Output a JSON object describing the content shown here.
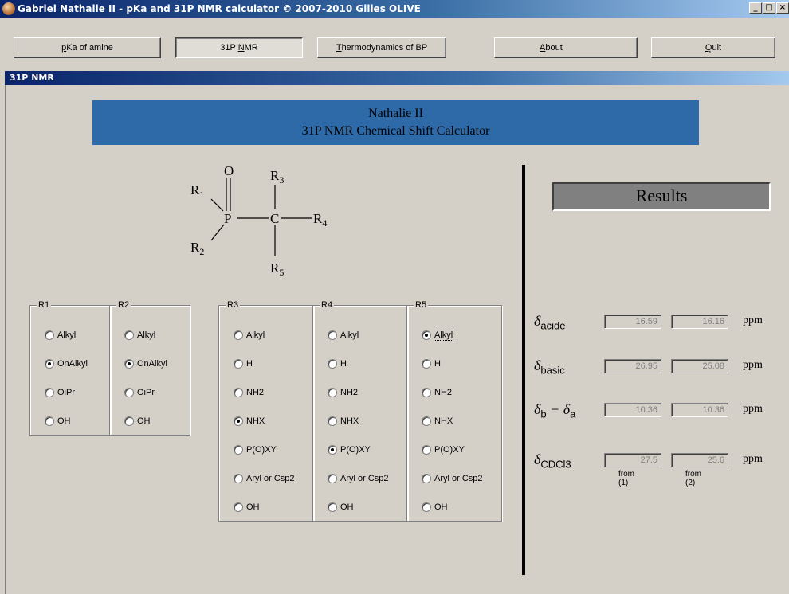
{
  "window": {
    "title": "Gabriel Nathalie II - pKa and 31P NMR calculator © 2007-2010 Gilles OLIVE",
    "min": "_",
    "max": "□",
    "close": "×"
  },
  "toolbar": {
    "pka": [
      "",
      "p",
      "Ka of amine"
    ],
    "nmr": [
      "31P ",
      "N",
      "MR"
    ],
    "thermo": [
      "",
      "T",
      "hermodynamics of BP"
    ],
    "about": [
      "",
      "A",
      "bout"
    ],
    "quit": [
      "",
      "Q",
      "uit"
    ]
  },
  "child": {
    "title": "31P NMR"
  },
  "banner": {
    "line1": "Nathalie II",
    "line2": "31P NMR Chemical Shift Calculator"
  },
  "molecule": {
    "O": "O",
    "P": "P",
    "C": "C",
    "R1": [
      "R",
      "1"
    ],
    "R2": [
      "R",
      "2"
    ],
    "R3": [
      "R",
      "3"
    ],
    "R4": [
      "R",
      "4"
    ],
    "R5": [
      "R",
      "5"
    ]
  },
  "groups": {
    "R1": {
      "label": "R1",
      "options": [
        "Alkyl",
        "OnAlkyl",
        "OiPr",
        "OH"
      ],
      "selected": 1
    },
    "R2": {
      "label": "R2",
      "options": [
        "Alkyl",
        "OnAlkyl",
        "OiPr",
        "OH"
      ],
      "selected": 1
    },
    "R3": {
      "label": "R3",
      "options": [
        "Alkyl",
        "H",
        "NH2",
        "NHX",
        "P(O)XY",
        "Aryl or Csp2",
        "OH"
      ],
      "selected": 3
    },
    "R4": {
      "label": "R4",
      "options": [
        "Alkyl",
        "H",
        "NH2",
        "NHX",
        "P(O)XY",
        "Aryl or Csp2",
        "OH"
      ],
      "selected": 4
    },
    "R5": {
      "label": "R5",
      "options": [
        "Alkyl",
        "H",
        "NH2",
        "NHX",
        "P(O)XY",
        "Aryl or Csp2",
        "OH"
      ],
      "selected": 0
    }
  },
  "results": {
    "title": "Results",
    "unit": "ppm",
    "rows": [
      {
        "symbol": "δ",
        "sub": "acide",
        "v1": "16.59",
        "v2": "16.16"
      },
      {
        "symbol": "δ",
        "sub": "basic",
        "v1": "26.95",
        "v2": "25.08"
      },
      {
        "symbol": "δ",
        "sub": "b",
        "mid": " − δ",
        "sub2": "a",
        "v1": "10.36",
        "v2": "10.36"
      },
      {
        "symbol": "δ",
        "sub": "CDCl3",
        "v1": "27.5",
        "v2": "25.6"
      }
    ],
    "from1": "from (1)",
    "from2": "from (2)"
  }
}
